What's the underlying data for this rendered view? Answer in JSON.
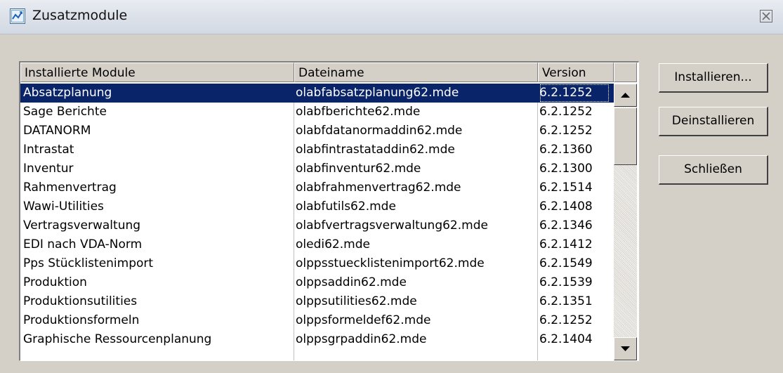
{
  "window": {
    "title": "Zusatzmodule"
  },
  "table": {
    "columns": [
      "Installierte Module",
      "Dateiname",
      "Version"
    ],
    "selected_index": 0,
    "rows": [
      {
        "name": "Absatzplanung",
        "file": "olabfabsatzplanung62.mde",
        "version": "6.2.1252"
      },
      {
        "name": "Sage Berichte",
        "file": "olabfberichte62.mde",
        "version": "6.2.1252"
      },
      {
        "name": "DATANORM",
        "file": "olabfdatanormaddin62.mde",
        "version": "6.2.1252"
      },
      {
        "name": "Intrastat",
        "file": "olabfintrastataddin62.mde",
        "version": "6.2.1360"
      },
      {
        "name": "Inventur",
        "file": "olabfinventur62.mde",
        "version": "6.2.1300"
      },
      {
        "name": "Rahmenvertrag",
        "file": "olabfrahmenvertrag62.mde",
        "version": "6.2.1514"
      },
      {
        "name": "Wawi-Utilities",
        "file": "olabfutils62.mde",
        "version": "6.2.1408"
      },
      {
        "name": "Vertragsverwaltung",
        "file": "olabfvertragsverwaltung62.mde",
        "version": "6.2.1346"
      },
      {
        "name": "EDI nach VDA-Norm",
        "file": "oledi62.mde",
        "version": "6.2.1412"
      },
      {
        "name": "Pps Stücklistenimport",
        "file": "olppsstuecklistenimport62.mde",
        "version": "6.2.1549"
      },
      {
        "name": "Produktion",
        "file": "olppsaddin62.mde",
        "version": "6.2.1539"
      },
      {
        "name": "Produktionsutilities",
        "file": "olppsutilities62.mde",
        "version": "6.2.1351"
      },
      {
        "name": "Produktionsformeln",
        "file": "olppsformeldef62.mde",
        "version": "6.2.1252"
      },
      {
        "name": "Graphische Ressourcenplanung",
        "file": "olppsgrpaddin62.mde",
        "version": "6.2.1404"
      }
    ]
  },
  "buttons": {
    "install": "Installieren...",
    "uninstall": "Deinstallieren",
    "close": "Schließen"
  },
  "colors": {
    "selection": "#0a246a",
    "face": "#d4d0c8"
  },
  "icons": {
    "app": "chart-icon",
    "close": "close-icon",
    "scroll_up": "arrow-up-icon",
    "scroll_down": "arrow-down-icon"
  }
}
